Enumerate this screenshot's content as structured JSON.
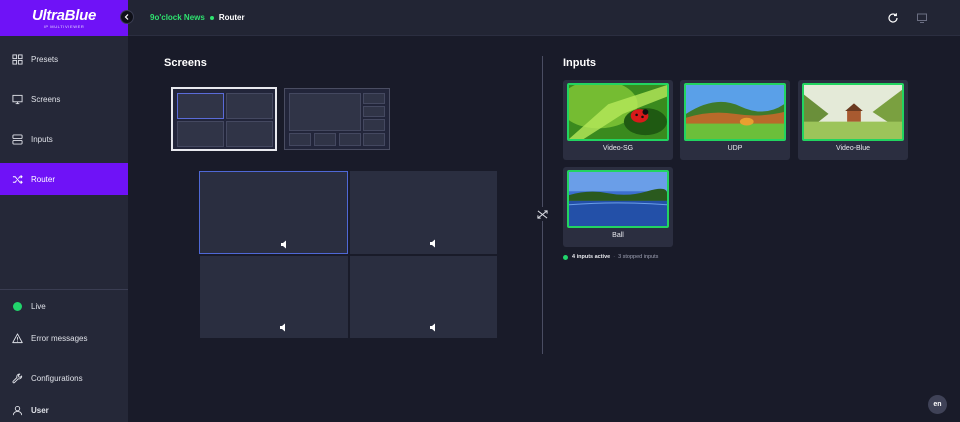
{
  "brand": {
    "name": "UltraBlue",
    "tagline": "IP MULTIVIEWER"
  },
  "header": {
    "project": "9o'clock News",
    "page": "Router"
  },
  "sidebar": {
    "items": [
      {
        "label": "Presets",
        "icon": "grid-icon"
      },
      {
        "label": "Screens",
        "icon": "monitor-icon"
      },
      {
        "label": "Inputs",
        "icon": "server-icon"
      },
      {
        "label": "Router",
        "icon": "shuffle-icon",
        "active": true
      }
    ],
    "bottom": [
      {
        "label": "Live",
        "icon": "live-dot"
      },
      {
        "label": "Error messages",
        "icon": "warning-icon"
      },
      {
        "label": "Configurations",
        "icon": "wrench-icon"
      },
      {
        "label": "User",
        "icon": "user-icon"
      }
    ]
  },
  "screens": {
    "title": "Screens"
  },
  "inputs": {
    "title": "Inputs",
    "cards": [
      {
        "label": "Video-SG",
        "scene": "ladybug"
      },
      {
        "label": "UDP",
        "scene": "meadow"
      },
      {
        "label": "Video-Blue",
        "scene": "cabin"
      },
      {
        "label": "Ball",
        "scene": "lake"
      }
    ],
    "stats": {
      "active": "4 inputs active",
      "stopped": "3 stopped inputs"
    }
  },
  "language": "en",
  "colors": {
    "accent": "#6f12f7",
    "live": "#21d46b",
    "selection": "#4f68d6"
  }
}
